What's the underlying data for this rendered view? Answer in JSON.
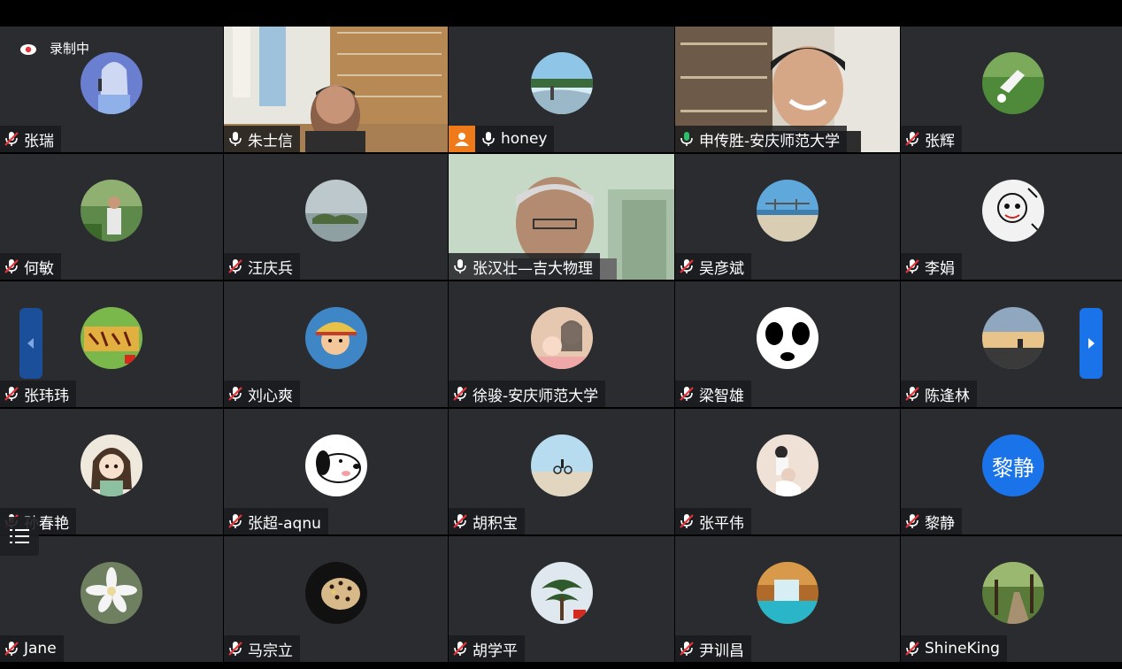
{
  "recording": {
    "label": "录制中"
  },
  "participants": [
    {
      "name": "张瑞",
      "mic": "muted",
      "kind": "avatar",
      "avatar": "girl-microphone-photo"
    },
    {
      "name": "朱士信",
      "mic": "on",
      "kind": "video",
      "avatar": "bookshelf-room-video"
    },
    {
      "name": "honey",
      "mic": "on",
      "kind": "avatar",
      "avatar": "waterfall-photo",
      "host": true
    },
    {
      "name": "申传胜-安庆师范大学",
      "mic": "active",
      "kind": "video",
      "avatar": "office-smiling-man-video"
    },
    {
      "name": "张辉",
      "mic": "muted",
      "kind": "avatar",
      "avatar": "soccer-field-photo"
    },
    {
      "name": "何敏",
      "mic": "muted",
      "kind": "avatar",
      "avatar": "garden-man-photo"
    },
    {
      "name": "汪庆兵",
      "mic": "muted",
      "kind": "avatar",
      "avatar": "lake-islands-photo"
    },
    {
      "name": "张汉壮—吉大物理",
      "mic": "on",
      "kind": "video",
      "avatar": "grey-hair-man-video"
    },
    {
      "name": "吴彦斌",
      "mic": "muted",
      "kind": "avatar",
      "avatar": "bridge-beach-photo"
    },
    {
      "name": "李娟",
      "mic": "muted",
      "kind": "avatar",
      "avatar": "doodle-art-photo"
    },
    {
      "name": "张玮玮",
      "mic": "muted",
      "kind": "avatar",
      "avatar": "calligraphy-sign-photo"
    },
    {
      "name": "刘心爽",
      "mic": "muted",
      "kind": "avatar",
      "avatar": "cartoon-pirate-photo"
    },
    {
      "name": "徐骏-安庆师范大学",
      "mic": "muted",
      "kind": "avatar",
      "avatar": "mother-baby-photo"
    },
    {
      "name": "梁智雄",
      "mic": "muted",
      "kind": "avatar",
      "avatar": "panda-face-photo"
    },
    {
      "name": "陈逢林",
      "mic": "muted",
      "kind": "avatar",
      "avatar": "sunset-sky-photo"
    },
    {
      "name": "孙春艳",
      "mic": "muted",
      "kind": "avatar",
      "avatar": "anime-girl-photo"
    },
    {
      "name": "张超-aqnu",
      "mic": "muted",
      "kind": "avatar",
      "avatar": "snoopy-photo"
    },
    {
      "name": "胡积宝",
      "mic": "muted",
      "kind": "avatar",
      "avatar": "cyclist-beach-photo"
    },
    {
      "name": "张平伟",
      "mic": "muted",
      "kind": "avatar",
      "avatar": "wedding-couple-photo"
    },
    {
      "name": "黎静",
      "mic": "muted",
      "kind": "text",
      "avatar_text": "黎静"
    },
    {
      "name": "Jane",
      "mic": "muted",
      "kind": "avatar",
      "avatar": "white-flower-photo"
    },
    {
      "name": "马宗立",
      "mic": "muted",
      "kind": "avatar",
      "avatar": "leopard-photo"
    },
    {
      "name": "胡学平",
      "mic": "muted",
      "kind": "avatar",
      "avatar": "pine-tree-photo"
    },
    {
      "name": "尹训昌",
      "mic": "muted",
      "kind": "avatar",
      "avatar": "waterfall-pool-photo"
    },
    {
      "name": "ShineKing",
      "mic": "muted",
      "kind": "avatar",
      "avatar": "forest-path-photo"
    }
  ],
  "colors": {
    "tile_bg": "#2a2c30",
    "accent_blue": "#1a73e8",
    "speaking_green": "#2bbf6a",
    "muted_red": "#e8333a",
    "host_orange": "#ef7a1a"
  }
}
